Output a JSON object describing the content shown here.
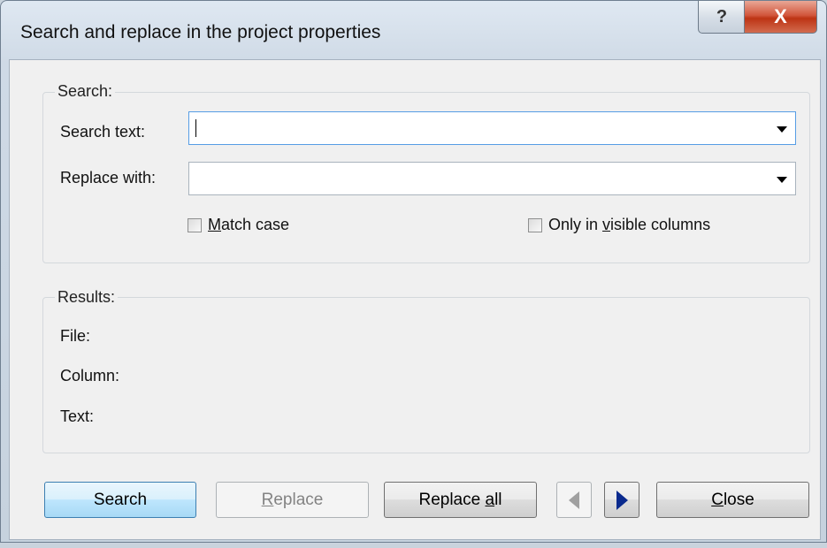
{
  "window": {
    "title": "Search and replace in the project properties",
    "help_glyph": "?",
    "close_glyph": "X"
  },
  "search_group": {
    "label": "Search:",
    "search_text_label": "Search text:",
    "search_text_value": "",
    "replace_with_label": "Replace with:",
    "replace_with_value": "",
    "match_case": {
      "mnemonic": "M",
      "rest": "atch case",
      "checked": false
    },
    "only_visible": {
      "pre": "Only in ",
      "mnemonic": "v",
      "rest": "isible columns",
      "checked": false
    }
  },
  "results_group": {
    "label": "Results:",
    "file_label": "File:",
    "column_label": "Column:",
    "text_label": "Text:"
  },
  "buttons": {
    "search": "Search",
    "replace": {
      "mnemonic": "R",
      "rest": "eplace"
    },
    "replace_all": {
      "pre": "Replace ",
      "mnemonic": "a",
      "rest": "ll"
    },
    "close": {
      "mnemonic": "C",
      "rest": "lose"
    }
  },
  "icons": {
    "prev": "triangle-left-icon",
    "next": "triangle-right-icon"
  }
}
